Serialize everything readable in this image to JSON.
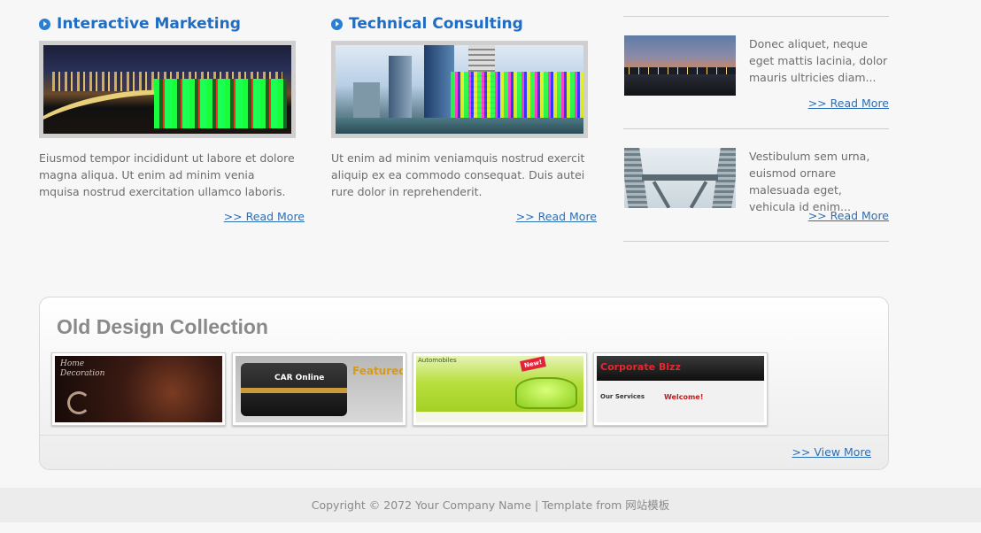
{
  "services": [
    {
      "title": "Interactive Marketing",
      "image": "city-night-bridge",
      "text": "Eiusmod tempor incididunt ut labore et dolore magna aliqua. Ut enim ad minim venia mquisa nostrud exercitation ullamco laboris.",
      "link": ">> Read More"
    },
    {
      "title": "Technical Consulting",
      "image": "city-skyline-day",
      "text": "Ut enim ad minim veniamquis nostrud exercit aliquip ex ea commodo consequat. Duis autei rure dolor in reprehenderit.",
      "link": ">> Read More"
    }
  ],
  "news": [
    {
      "image": "dusk-skyline",
      "text": "Donec aliquet, neque eget mattis lacinia, dolor mauris ultricies diam...",
      "link": ">> Read More"
    },
    {
      "image": "twin-towers-bridge",
      "text": "Vestibulum sem urna, euismod ornare malesuada eget, vehicula id enim...",
      "link": ">> Read More"
    }
  ],
  "collection": {
    "title": "Old Design Collection",
    "items": [
      {
        "name": "home-decoration",
        "label_lines": [
          "Home",
          "Decoration"
        ]
      },
      {
        "name": "car-online",
        "label": "CAR Online",
        "featured": "Featured C"
      },
      {
        "name": "automobiles",
        "header": "Automobiles",
        "badge": "New!"
      },
      {
        "name": "corporate-bizz",
        "brand": "Corporate Bizz",
        "services": "Our Services",
        "welcome": "Welcome!"
      }
    ],
    "view_more": ">> View More"
  },
  "footer": {
    "text": "Copyright © 2072 Your Company Name | Template from 网站模板"
  },
  "colors": {
    "accent_blue": "#1f6cc4",
    "link_blue": "#2b6fb7",
    "text_gray": "#6d6d6d",
    "background": "#f7f7f7"
  }
}
